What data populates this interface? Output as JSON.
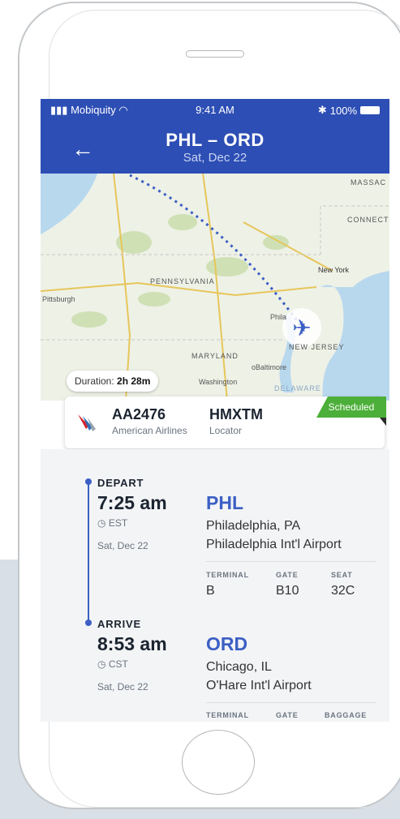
{
  "status_bar": {
    "carrier": "Mobiquity",
    "time": "9:41 AM",
    "battery": "100%"
  },
  "header": {
    "back_icon": "←",
    "route": "PHL – ORD",
    "date": "Sat, Dec 22"
  },
  "map": {
    "labels": {
      "massachusetts": "MASSAC",
      "connecticut": "CONNECT",
      "pennsylvania": "PENNSYLVANIA",
      "pittsburgh": "Pittsburgh",
      "new_york": "New York",
      "maryland": "MARYLAND",
      "baltimore": "oBaltimore",
      "new_jersey": "NEW JERSEY",
      "washington": "Washington",
      "delaware": "DELAWARE",
      "philadelphia": "Phila"
    },
    "duration_label": "Duration:",
    "duration_value": "2h 28m"
  },
  "flight_card": {
    "flight_number": "AA2476",
    "airline": "American Airlines",
    "locator_code": "HMXTM",
    "locator_label": "Locator",
    "status": "Scheduled",
    "status_color": "#4caf39"
  },
  "depart": {
    "label": "DEPART",
    "time": "7:25 am",
    "timezone": "EST",
    "date": "Sat, Dec 22",
    "code": "PHL",
    "city": "Philadelphia, PA",
    "airport": "Philadelphia Int'l Airport",
    "terminal_label": "TERMINAL",
    "terminal": "B",
    "gate_label": "GATE",
    "gate": "B10",
    "seat_label": "SEAT",
    "seat": "32C"
  },
  "arrive": {
    "label": "ARRIVE",
    "time": "8:53 am",
    "timezone": "CST",
    "date": "Sat, Dec 22",
    "code": "ORD",
    "city": "Chicago, IL",
    "airport": "O'Hare Int'l Airport",
    "terminal_label": "TERMINAL",
    "gate_label": "GATE",
    "baggage_label": "BAGGAGE"
  },
  "colors": {
    "header": "#2d4eb4",
    "accent": "#3b5fc4"
  }
}
